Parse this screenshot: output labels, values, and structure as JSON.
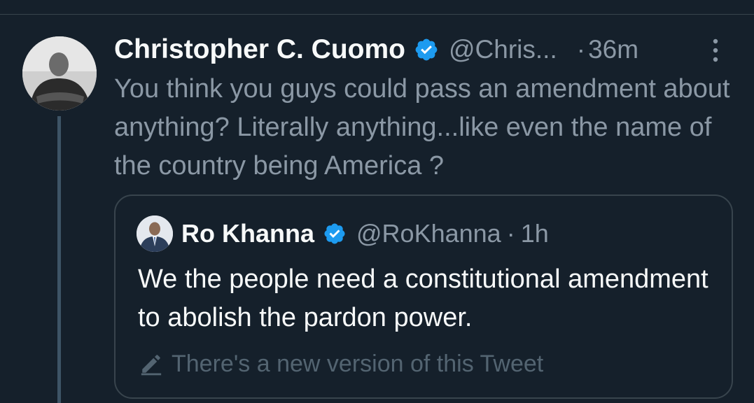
{
  "tweet": {
    "author_name": "Christopher C. Cuomo",
    "handle": "@Chris...",
    "separator": "·",
    "time": "36m",
    "text": "You think you guys could pass an amendment about anything? Literally anything...like even the name of the country being America ?",
    "verified_icon": "verified-badge-icon",
    "more_icon": "more-vertical-icon"
  },
  "quote": {
    "author_name": "Ro Khanna",
    "handle": "@RoKhanna",
    "separator": "·",
    "time": "1h",
    "text": "We the people need a constitutional amendment to abolish the pardon power.",
    "notice": "There's a new version of this Tweet",
    "notice_icon": "pencil-icon"
  },
  "colors": {
    "background": "#15202b",
    "primary_text": "#f7f9f9",
    "secondary_text": "#8b98a5",
    "verified_blue": "#1d9bf0",
    "border": "#38444d"
  }
}
